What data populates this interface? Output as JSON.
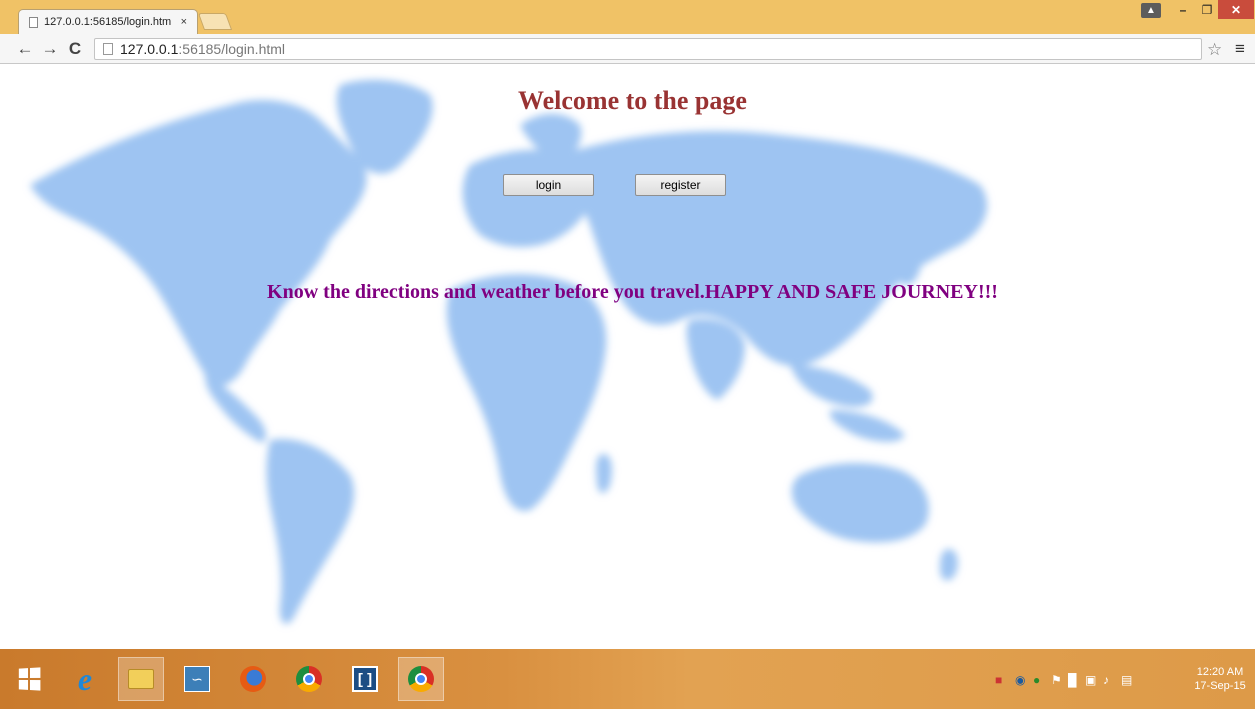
{
  "browser": {
    "tab_title": "127.0.0.1:56185/login.htm",
    "tab_close": "×",
    "url_host": "127.0.0.1",
    "url_path": ":56185/login.html",
    "icons": [
      "page-icon",
      "back-arrow-icon",
      "forward-arrow-icon",
      "reload-icon",
      "star-icon",
      "menu-icon",
      "user-icon",
      "minimize-icon",
      "maximize-icon",
      "close-icon"
    ]
  },
  "page": {
    "heading": "Welcome to the page",
    "login_label": "login",
    "register_label": "register",
    "tagline": "Know the directions and weather before you travel.HAPPY AND SAFE JOURNEY!!!",
    "heading_color": "#993333",
    "tagline_color": "#800080",
    "map_color": "#9ec4f2"
  },
  "taskbar": {
    "apps": [
      "windows-start-icon",
      "internet-explorer-icon",
      "file-explorer-icon",
      "mysql-workbench-icon",
      "firefox-icon",
      "chrome-icon",
      "brackets-icon",
      "chrome-icon"
    ],
    "clock_time": "12:20 AM",
    "clock_date": "17-Sep-15"
  }
}
